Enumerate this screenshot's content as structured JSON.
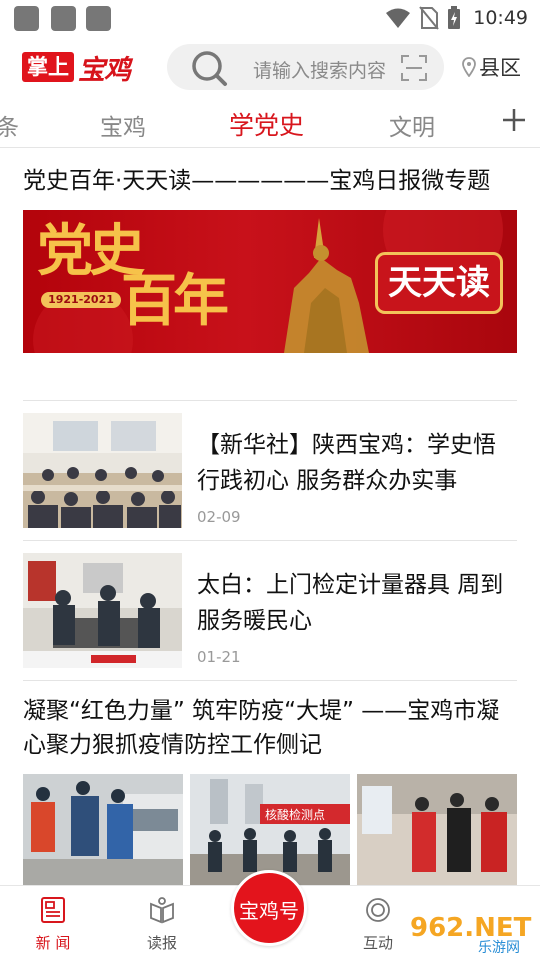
{
  "status_bar": {
    "time": "10:49"
  },
  "header": {
    "logo_box": "掌上",
    "logo_text": "宝鸡",
    "search_placeholder": "请输入搜索内容",
    "county": "县区"
  },
  "tabs": [
    {
      "label": "条",
      "active": false
    },
    {
      "label": "宝鸡",
      "active": false
    },
    {
      "label": "学党史",
      "active": true
    },
    {
      "label": "文明",
      "active": false
    }
  ],
  "feed": {
    "topic_title": "党史百年·天天读——————宝鸡日报微专题",
    "banner": {
      "line1": "党史",
      "line2": "百年",
      "years": "1921-2021",
      "badge": "天天读"
    },
    "rows": [
      {
        "title": "【新华社】陕西宝鸡：学史悟行践初心 服务群众办实事",
        "date": "02-09"
      },
      {
        "title": "太白：上门检定计量器具 周到服务暖民心",
        "date": "01-21"
      }
    ],
    "gallery_title": "凝聚“红色力量” 筑牢防疫“大堤” ——宝鸡市凝心聚力狠抓疫情防控工作侧记",
    "gallery_sign": "核酸检测点"
  },
  "bottom_nav": {
    "items": [
      {
        "label": "新 闻",
        "active": true
      },
      {
        "label": "读报",
        "active": false
      },
      {
        "label": "互动",
        "active": false
      }
    ],
    "center_label": "宝鸡号"
  },
  "watermark": {
    "text": "962.NET",
    "sub": "乐游网"
  },
  "colors": {
    "brand_red": "#d8161d",
    "banner_gold": "#f6c24a"
  }
}
